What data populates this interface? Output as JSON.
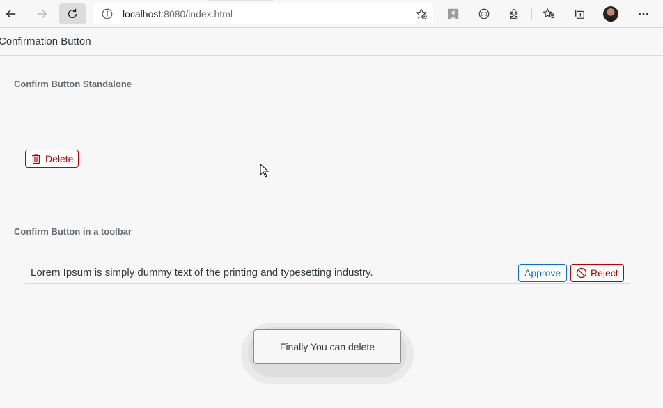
{
  "browser": {
    "url_host": "localhost",
    "url_rest": ":8080/index.html",
    "icons": [
      "back-icon",
      "forward-icon",
      "reload-icon",
      "info-icon",
      "add-favorite-icon",
      "profile-image-icon",
      "reading-mode-icon",
      "extensions-icon",
      "favorites-icon",
      "collections-icon",
      "avatar",
      "more-icon"
    ]
  },
  "page": {
    "title": "Confirmation Button"
  },
  "standalone": {
    "heading": "Confirm Button Standalone",
    "delete_label": "Delete"
  },
  "toolbar_section": {
    "heading": "Confirm Button in a toolbar",
    "text": "Lorem Ipsum is simply dummy text of the printing and typesetting industry.",
    "approve_label": "Approve",
    "reject_label": "Reject"
  },
  "toast": {
    "message": "Finally You can delete"
  },
  "colors": {
    "reject": "#bb0000",
    "accept": "#0a6ed1",
    "background": "#f7f7f7"
  }
}
